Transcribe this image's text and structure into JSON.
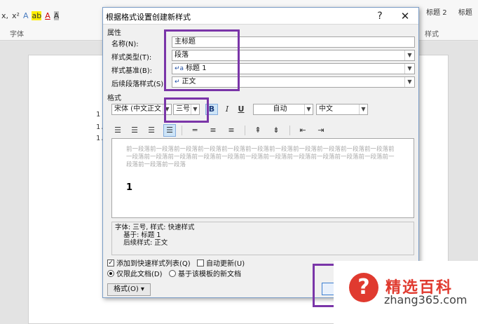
{
  "ribbon": {
    "font_tools": [
      "x,",
      "x²",
      "A",
      "ab",
      "A",
      "A"
    ],
    "style_items": [
      "标题 2",
      "标题"
    ],
    "group_font_label": "字体",
    "group_style_label": "样式"
  },
  "document": {
    "list_numbers": [
      "1",
      "1.",
      "1."
    ]
  },
  "dialog": {
    "title": "根据格式设置创建新样式",
    "help_label": "?",
    "close_label": "✕",
    "properties_section": "属性",
    "name_label": "名称(N):",
    "name_value": "主标题",
    "style_type_label": "样式类型(T):",
    "style_type_value": "段落",
    "based_on_label": "样式基准(B):",
    "based_on_value": "标题 1",
    "next_para_label": "后续段落样式(S):",
    "next_para_value": "正文",
    "format_section": "格式",
    "font_value": "宋体 (中文正文",
    "size_value": "三号",
    "bold_label": "B",
    "italic_label": "I",
    "underline_label": "U",
    "color_value": "自动",
    "script_value": "中文",
    "preview_prev_text": "前一段落前一段落前一段落前一段落前一段落前一段落前一段落前一段落前一段落前一段落前一段落前一段落前一段落前一段落前一段落前一段落前一段落前一段落前一段落前一段落前一段落前一段落前一段落前一段落前一段落",
    "preview_sample": "1",
    "description_lines": [
      "字体: 三号, 样式: 快速样式",
      "    基于: 标题 1",
      "    后续样式: 正文"
    ],
    "add_quick_style_label": "添加到快速样式列表(Q)",
    "auto_update_label": "自动更新(U)",
    "only_this_doc_label": "仅限此文档(D)",
    "new_docs_label": "基于该模板的新文档",
    "format_button_label": "格式(O) ▾"
  },
  "watermark": {
    "title": "精选百科",
    "site": "zhang365.com"
  },
  "colors": {
    "highlight": "#7a35a8",
    "watermark_red": "#e03a2f"
  }
}
